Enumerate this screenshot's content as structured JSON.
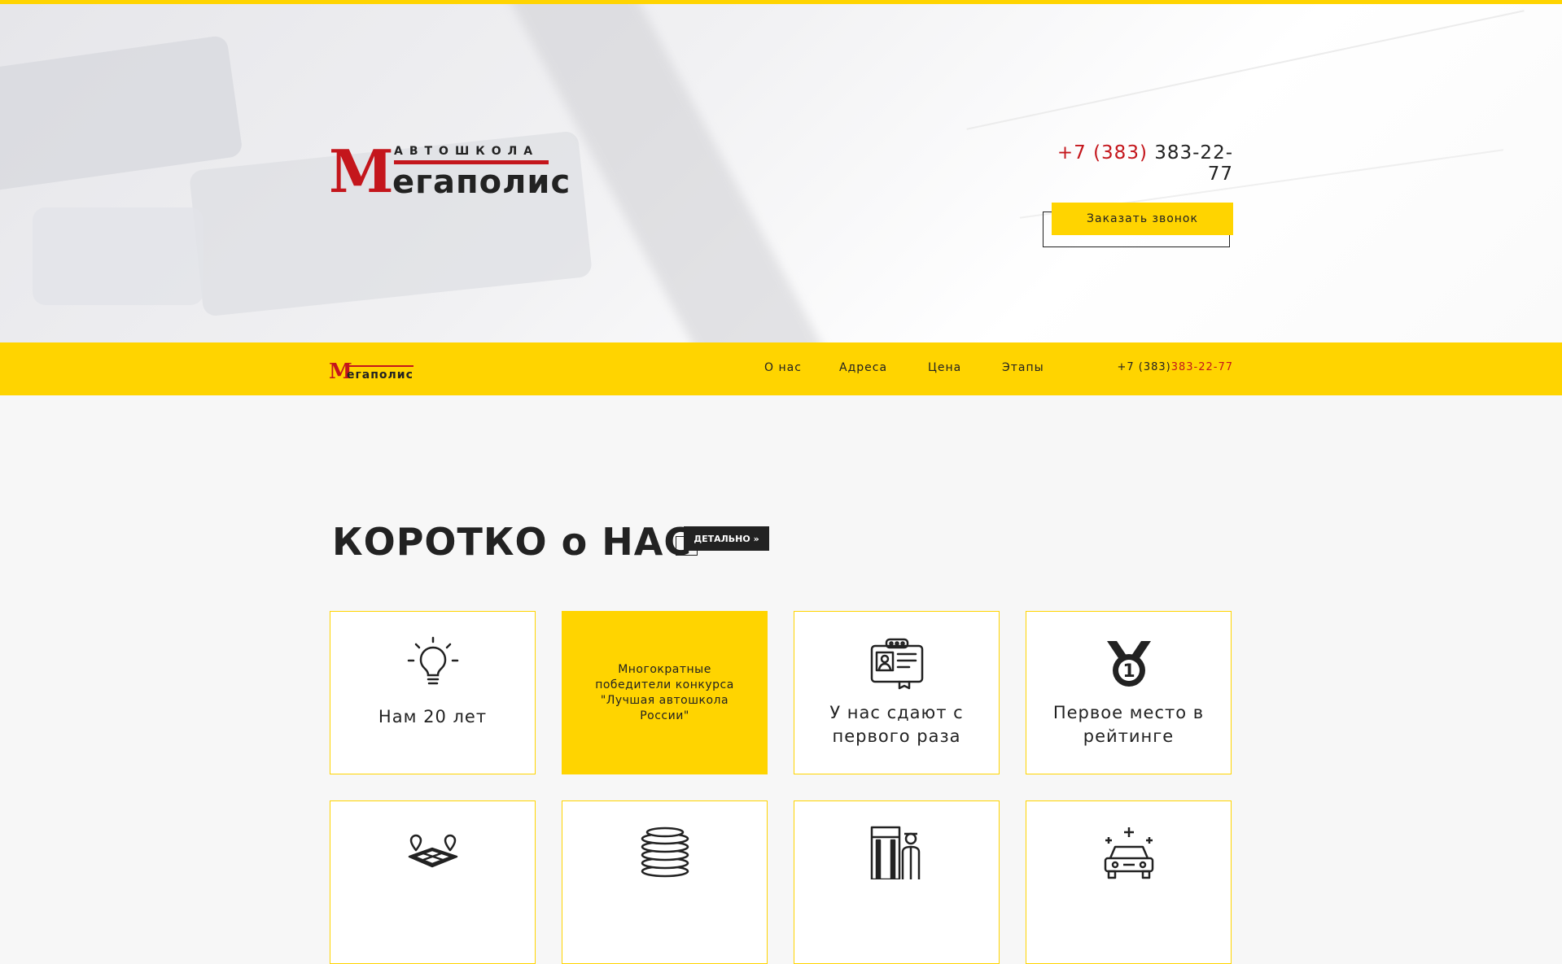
{
  "header": {
    "logo": {
      "letter": "М",
      "rest": "егаполис",
      "top_line": "АВТОШКОЛА"
    },
    "phone": {
      "code": "+7 (383)",
      "number": "383-22-77"
    },
    "callback_label": "Заказать звонок"
  },
  "nav": {
    "logo": {
      "letter": "М",
      "rest": "егаполис"
    },
    "items": [
      {
        "label": "О нас"
      },
      {
        "label": "Адреса"
      },
      {
        "label": "Цена"
      },
      {
        "label": "Этапы"
      }
    ],
    "phone": {
      "code": "+7 (383)",
      "number": "383-22-77"
    }
  },
  "about": {
    "title": "КОРОТКО о НАС",
    "detail_label": "ДЕТАЛЬНО »",
    "cards": [
      {
        "icon": "lightbulb-icon",
        "title": "Нам 20 лет"
      },
      {
        "text": "Многократные победители конкурса \"Лучшая автошкола России\""
      },
      {
        "icon": "driver-license-icon",
        "title": "У нас сдают с первого раза"
      },
      {
        "icon": "medal-icon",
        "title": "Первое место в рейтинге"
      }
    ],
    "cards_row2": [
      {
        "icon": "map-pins-icon"
      },
      {
        "icon": "coins-icon"
      },
      {
        "icon": "police-checkpoint-icon"
      },
      {
        "icon": "car-icon"
      }
    ],
    "colors": {
      "accent": "#ffd400",
      "brand_red": "#c4161c",
      "dark": "#222222"
    }
  }
}
